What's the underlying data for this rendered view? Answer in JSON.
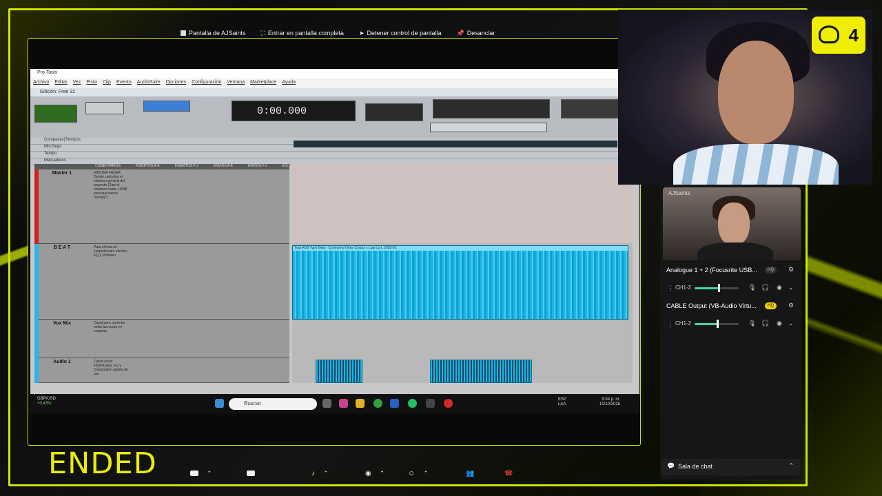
{
  "participant_count": "4",
  "ended_label": "ENDED",
  "share_bar": {
    "screen_label": "Pantalla de AJSaints",
    "fullscreen_label": "Entrar en pantalla completa",
    "stop_control_label": "Detener control de pantalla",
    "unpin_label": "Desanclar"
  },
  "protools": {
    "window_title": "Pro Tools",
    "menu": [
      "Archivo",
      "Editar",
      "Vez",
      "Pista",
      "Clip",
      "Evento",
      "AudioSuite",
      "Opciones",
      "Configuración",
      "Ventana",
      "Marketplace",
      "Ayuda"
    ],
    "edit_window": "Edición: Free 32",
    "counter": "0:00.000",
    "tracks": [
      {
        "name": "Master 1",
        "comment": "MASTER FADER Donde controlas el volumen general del proyecto (Sine el volumen hasta +10dB para que suene \"normal\")"
      },
      {
        "name": "B E A T",
        "comment": "Para el beat en conjunto para efectos, EQ y Volumen"
      },
      {
        "name": "Vox Mix",
        "comment": "Canal para controlar todas las voces en conjunto"
      },
      {
        "name": "Audio 1",
        "comment": "Canal voces individuales, EQ y Compresión aparte de sus"
      }
    ],
    "column_headers": [
      "COMENTARIOS",
      "INSERTOS A-E",
      "INSERTOS F-J",
      "ENVÍOS A-E",
      "ENVÍOS F-J",
      "E/S"
    ],
    "clip_label": "Trap RnB Type Beat - Conmemo Omar Courtz x Luar La L 2025-01",
    "ruler_rows": [
      "Compases|Tiempos",
      "Min:Segs",
      "Tempo",
      "Marcadores"
    ]
  },
  "taskbar": {
    "ticker_symbol": "GBP/USD",
    "ticker_change": "+0.43%",
    "search_placeholder": "Buscar",
    "lang": "ESP",
    "lang2": "LAA",
    "time": "9:34 p. m.",
    "date": "10/10/2025"
  },
  "sidebar": {
    "cam2_name": "AJSaints",
    "sources": [
      {
        "name": "Analogue 1 + 2 (Focusrite USB...",
        "badge": "HQ",
        "channel": "CH1-2",
        "level": 0.56
      },
      {
        "name": "CABLE Output (VB-Audio Virtu...",
        "badge": "HQ",
        "channel": "CH1-2",
        "level": 0.52
      }
    ],
    "chat_label": "Sala de chat"
  },
  "colors": {
    "accent": "#e8f000",
    "hq_active": "#f0d000",
    "slider": "#3fd9a0"
  }
}
